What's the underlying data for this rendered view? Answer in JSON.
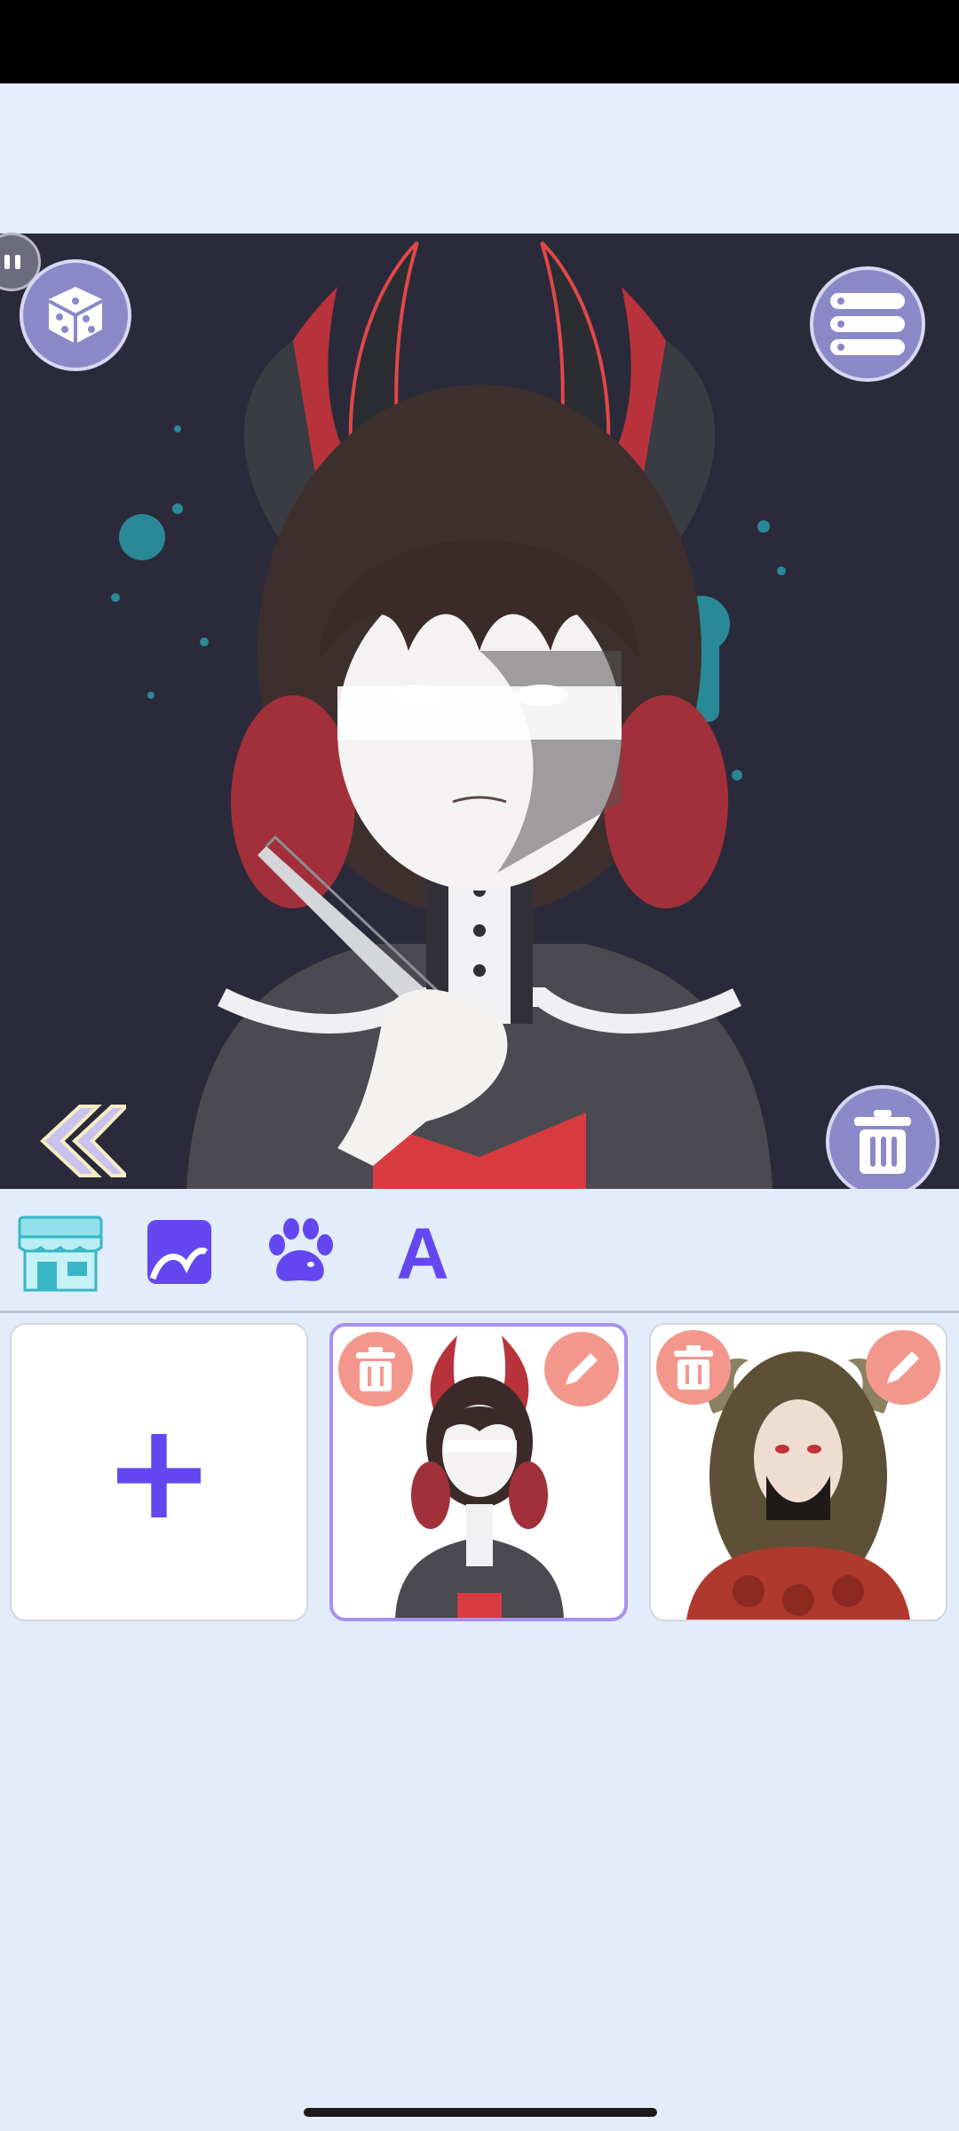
{
  "colors": {
    "accent": "#6447f0",
    "button_fill": "#8a88c6",
    "badge": "#f3978d",
    "canvas_bg": "#2a2a3b",
    "panel_bg": "#e2ecfb"
  },
  "canvas": {
    "dice_icon": "dice-icon",
    "menu_icon": "list-icon",
    "back_icon": "double-chevron-left-icon",
    "trash_icon": "trash-icon"
  },
  "toolbar": {
    "items": [
      {
        "icon": "shop-icon"
      },
      {
        "icon": "background-image-icon"
      },
      {
        "icon": "paw-icon"
      },
      {
        "icon": "text-icon",
        "glyph": "A"
      }
    ]
  },
  "gallery": {
    "add_glyph": "+",
    "cards": [
      {
        "selected": true,
        "icons": [
          "trash-icon",
          "pencil-icon"
        ]
      },
      {
        "selected": false,
        "icons": [
          "trash-icon",
          "pencil-icon"
        ]
      }
    ]
  }
}
